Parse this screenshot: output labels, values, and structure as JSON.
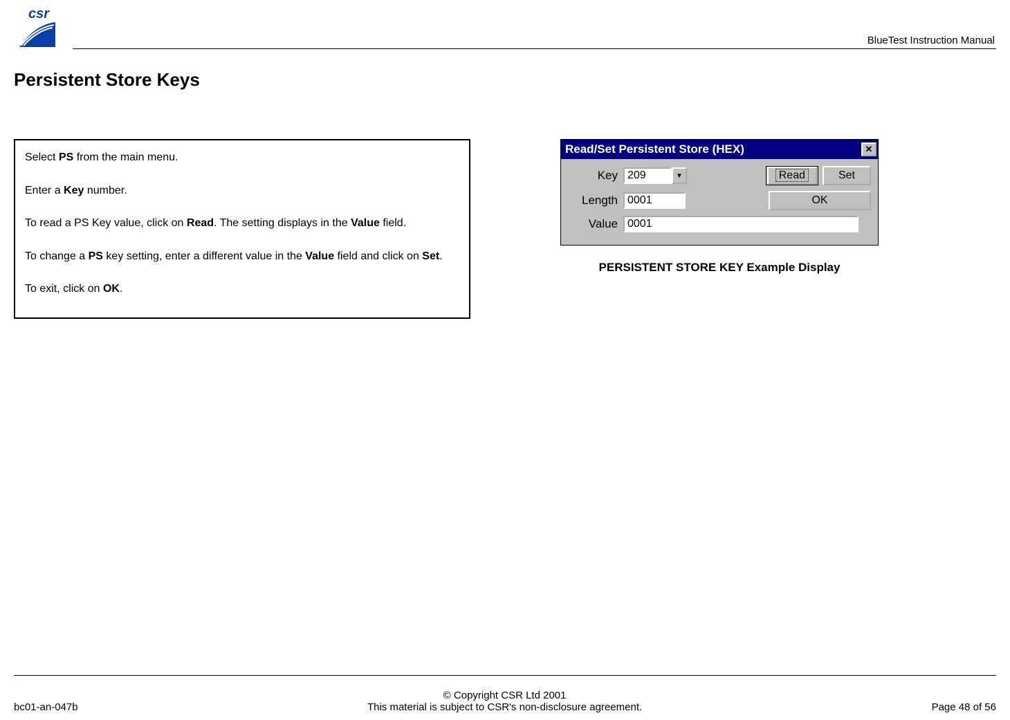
{
  "header": {
    "doc_title": "BlueTest Instruction Manual"
  },
  "page_title": "Persistent Store Keys",
  "instructions": {
    "p1_pre": "Select ",
    "p1_b": "PS",
    "p1_post": " from the main menu.",
    "p2_pre": "Enter a ",
    "p2_b": "Key",
    "p2_post": " number.",
    "p3_pre": "To read a PS Key value, click on ",
    "p3_b": "Read",
    "p3_mid": ". The setting displays in the ",
    "p3_b2": "Value",
    "p3_post": " field.",
    "p4_pre": "To change a ",
    "p4_b1": "PS",
    "p4_mid1": " key setting, enter a different value in the ",
    "p4_b2": "Value",
    "p4_mid2": " field and click on ",
    "p4_b3": "Set",
    "p4_post": ".",
    "p5_pre": "To exit, click on ",
    "p5_b": "OK",
    "p5_post": "."
  },
  "dialog": {
    "title": "Read/Set Persistent Store (HEX)",
    "labels": {
      "key": "Key",
      "length": "Length",
      "value": "Value"
    },
    "values": {
      "key": "209",
      "length": "0001",
      "value": "0001"
    },
    "buttons": {
      "read": "Read",
      "set": "Set",
      "ok": "OK"
    }
  },
  "figure_caption": "PERSISTENT STORE KEY Example Display",
  "footer": {
    "left": "bc01-an-047b",
    "center_line1": "© Copyright CSR Ltd 2001",
    "center_line2": "This material is subject to CSR's non-disclosure agreement.",
    "right": "Page 48 of 56"
  }
}
